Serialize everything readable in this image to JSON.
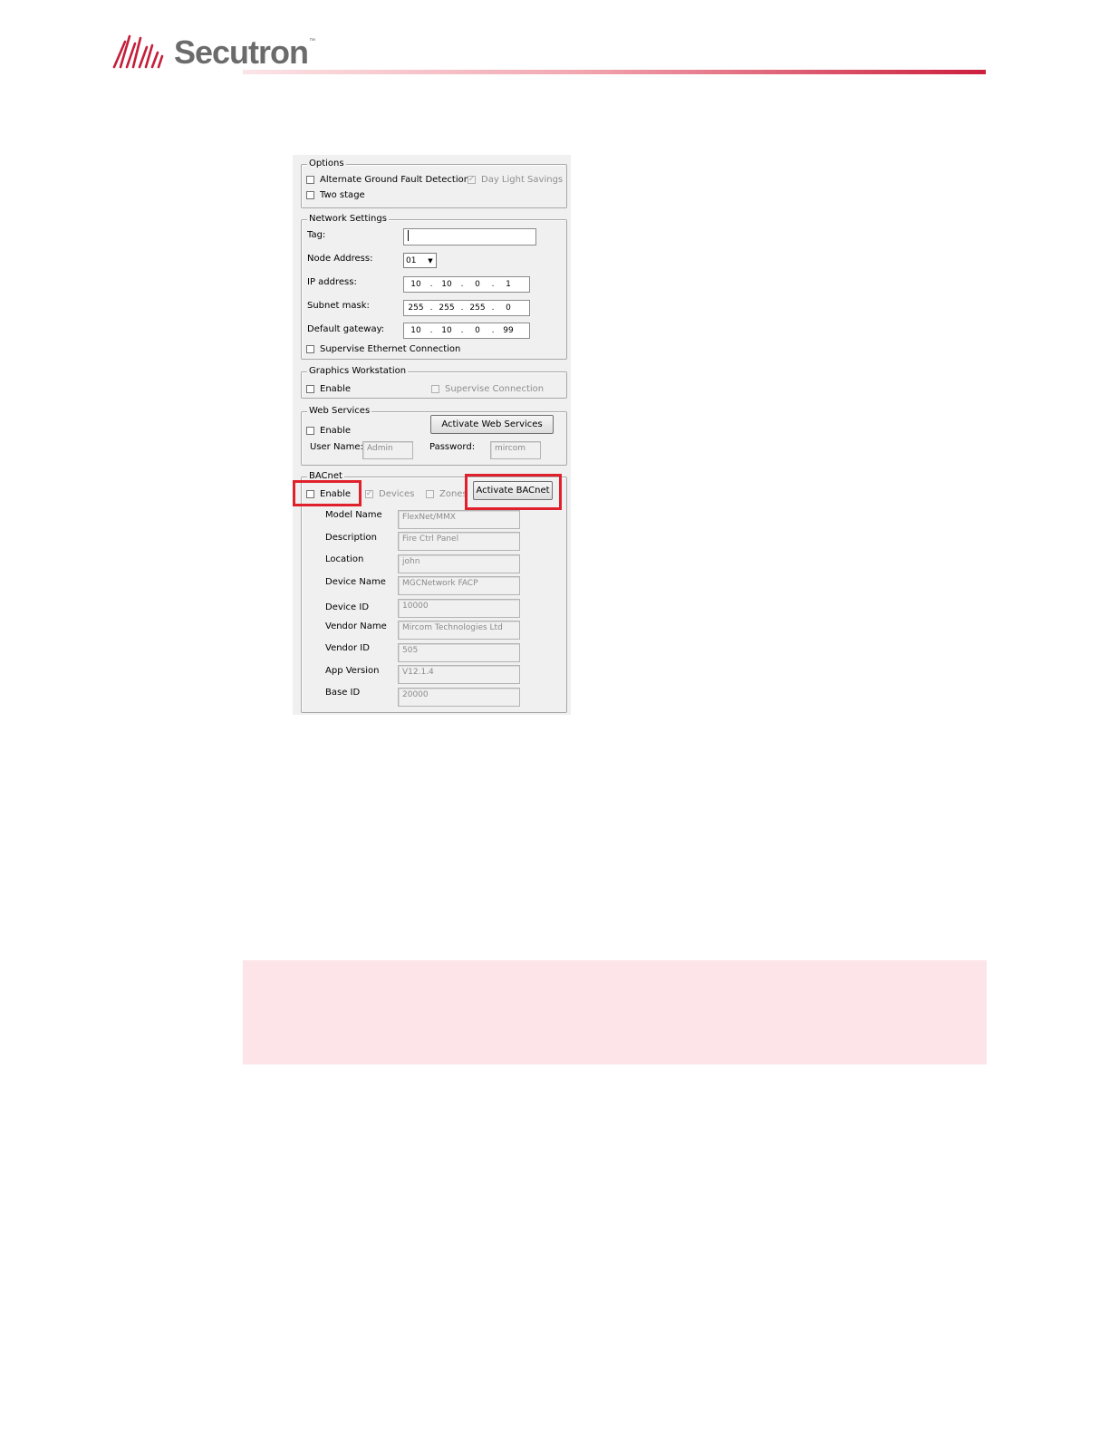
{
  "header": {
    "brand": "Secutron",
    "trademark": "™",
    "accent_color": "#cc1f3d",
    "logo_color": "#c41e3a"
  },
  "dialog": {
    "options": {
      "title": "Options",
      "alternate_ground_fault": {
        "label": "Alternate Ground Fault Detection",
        "checked": false
      },
      "day_light_savings": {
        "label": "Day Light Savings",
        "checked": true,
        "enabled": false
      },
      "two_stage": {
        "label": "Two stage",
        "checked": false
      }
    },
    "network": {
      "title": "Network Settings",
      "tag_label": "Tag:",
      "tag_value": "",
      "node_address_label": "Node Address:",
      "node_address_value": "01",
      "ip_label": "IP address:",
      "ip": [
        "10",
        "10",
        "0",
        "1"
      ],
      "subnet_label": "Subnet mask:",
      "subnet": [
        "255",
        "255",
        "255",
        "0"
      ],
      "gateway_label": "Default gateway:",
      "gateway": [
        "10",
        "10",
        "0",
        "99"
      ],
      "supervise_label": "Supervise Ethernet Connection",
      "supervise_checked": false
    },
    "graphics": {
      "title": "Graphics Workstation",
      "enable_label": "Enable",
      "supervise_label": "Supervise Connection"
    },
    "web_services": {
      "title": "Web Services",
      "enable_label": "Enable",
      "activate_label": "Activate Web Services",
      "username_label": "User Name:",
      "username_value": "Admin",
      "password_label": "Password:",
      "password_value": "mircom"
    },
    "bacnet": {
      "title": "BACnet",
      "enable_label": "Enable",
      "devices_label": "Devices",
      "zones_label": "Zones",
      "activate_label": "Activate BACnet",
      "fields": [
        {
          "label": "Model Name",
          "value": "FlexNet/MMX"
        },
        {
          "label": "Description",
          "value": "Fire Ctrl Panel"
        },
        {
          "label": "Location",
          "value": "john"
        },
        {
          "label": "Device Name",
          "value": "MGCNetwork FACP"
        },
        {
          "label": "Device ID",
          "value": "10000"
        },
        {
          "label": "Vendor Name",
          "value": "Mircom Technologies Ltd"
        },
        {
          "label": "Vendor ID",
          "value": "505"
        },
        {
          "label": "App Version",
          "value": "V12.1.4"
        },
        {
          "label": "Base ID",
          "value": "20000"
        }
      ]
    }
  },
  "highlight_color": "#e0212c",
  "note_panel_color": "#fce4e8"
}
